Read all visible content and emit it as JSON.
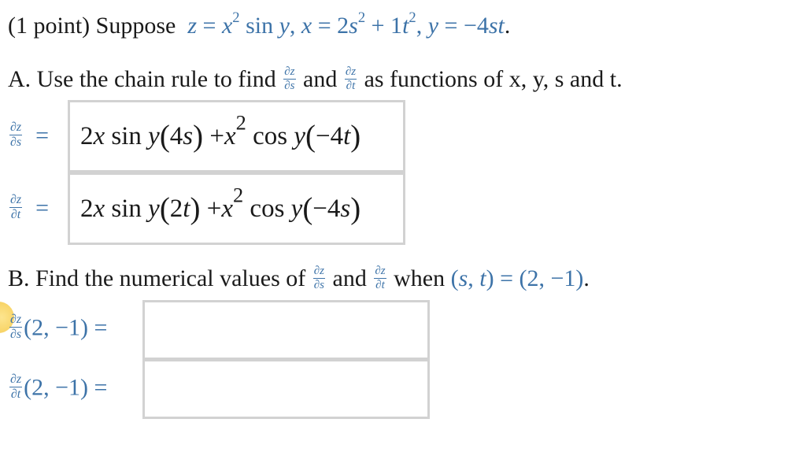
{
  "problem": {
    "points_label": "(1 point) Suppose",
    "given": {
      "z_def": "z = x² sin y",
      "x_def": "x = 2s² + 1t²",
      "y_def": "y = −4st"
    }
  },
  "part_a": {
    "prompt_prefix": "A. Use the chain rule to find",
    "and_label": "and",
    "prompt_suffix": "as functions of x, y, s and t.",
    "dz_ds": {
      "label": "∂z/∂s",
      "answer": "2x sin y(4s) + x² cos y(−4t)"
    },
    "dz_dt": {
      "label": "∂z/∂t",
      "answer": "2x sin y(2t) + x² cos y(−4s)"
    }
  },
  "part_b": {
    "prompt_prefix": "B. Find the numerical values of",
    "and_label": "and",
    "when_label": "when",
    "point": "(s, t) = (2, −1).",
    "dz_ds_at": {
      "label": "∂z/∂s (2, −1) =",
      "value": ""
    },
    "dz_dt_at": {
      "label": "∂z/∂t (2, −1) =",
      "value": ""
    }
  },
  "colors": {
    "math_blue": "#3d73a8",
    "box_border": "#d2d2d2",
    "highlight": "#f8d467"
  }
}
